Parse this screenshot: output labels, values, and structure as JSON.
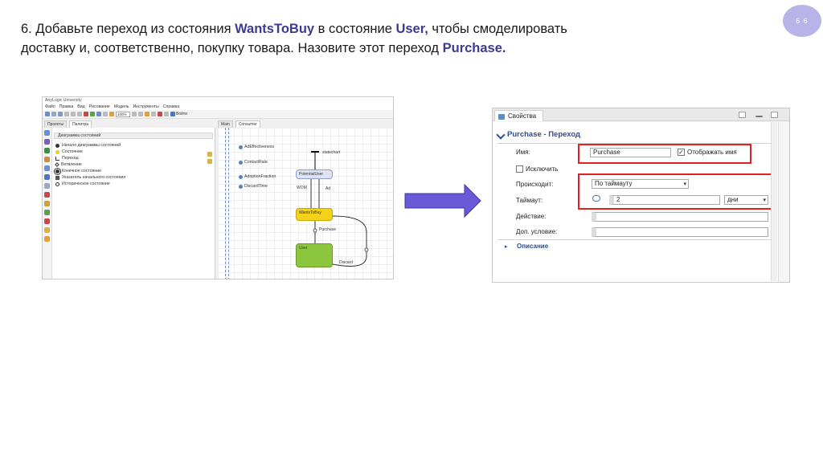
{
  "slide": {
    "page_number": "6 6",
    "heading_parts": [
      "6. Добавьте переход из состояния ",
      "WantsToBuy",
      " в состояние ",
      "User,",
      " чтобы смоделировать доставку и, соответственно, покупку товара. Назовите этот переход ",
      "Purchase."
    ]
  },
  "ide": {
    "window_title": "AnyLogic University",
    "menu": [
      "Файл",
      "Правка",
      "Вид",
      "Рисование",
      "Модель",
      "Инструменты",
      "Справка"
    ],
    "zoom": "100%",
    "run_label": "Войти",
    "panel_tabs": [
      "Проекты",
      "Палитра"
    ],
    "editor_tabs": [
      "Main",
      "Consumer"
    ],
    "palette_header": "Диаграмма состояний",
    "palette_items": [
      {
        "label": "Начало диаграммы состояний",
        "icon": "statechart-entry-icon"
      },
      {
        "label": "Состояние",
        "icon": "state-icon"
      },
      {
        "label": "Переход",
        "icon": "transition-icon"
      },
      {
        "label": "Ветвление",
        "icon": "branch-icon"
      },
      {
        "label": "Конечное состояние",
        "icon": "final-state-icon"
      },
      {
        "label": "Указатель начального состояния",
        "icon": "initial-pointer-icon"
      },
      {
        "label": "Историческое состояние",
        "icon": "history-state-icon"
      }
    ],
    "parameters": [
      "AdEffectiveness",
      "ContactRate",
      "AdoptionFraction",
      "DiscardTime"
    ],
    "statechart_label": "statechart",
    "states": {
      "potential": "PotentialUser",
      "wants": "WantsToBuy",
      "user": "User"
    },
    "transition_labels": {
      "wom": "WOM",
      "ad": "Ad",
      "purchase": "Purchase",
      "discard": "Discard"
    }
  },
  "properties": {
    "tab_label": "Свойства",
    "title": "Purchase - Переход",
    "name_label": "Имя:",
    "name_value": "Purchase",
    "show_name_label": "Отображать имя",
    "exclude_label": "Исключить",
    "occurs_label": "Происходит:",
    "occurs_value": "По таймауту",
    "timeout_label": "Таймаут:",
    "timeout_value": "2",
    "timeout_unit": "дни",
    "action_label": "Действие:",
    "condition_label": "Доп. условие:",
    "description_label": "Описание"
  },
  "colors": {
    "accent": "#3e3a8c",
    "arrow": "#6a59d6",
    "highlight_box": "#e31e24",
    "page_badge": "#b9b4e8",
    "state_yellow": "#f5d21a",
    "state_green": "#8cc63f"
  }
}
